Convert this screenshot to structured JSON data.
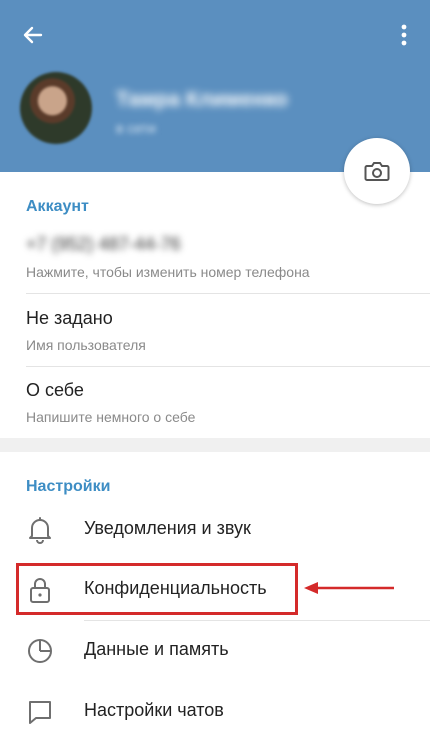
{
  "header": {
    "name": "Тамра Клименко",
    "status": "в сети",
    "accent_color": "#5b8fbf"
  },
  "account": {
    "title": "Аккаунт",
    "phone_value": "+7 (952) 487-44-76",
    "phone_hint": "Нажмите, чтобы изменить номер телефона",
    "username_value": "Не задано",
    "username_hint": "Имя пользователя",
    "bio_value": "О себе",
    "bio_hint": "Напишите немного о себе"
  },
  "settings": {
    "title": "Настройки",
    "items": [
      {
        "label": "Уведомления и звук",
        "icon": "bell-icon"
      },
      {
        "label": "Конфиденциальность",
        "icon": "lock-icon"
      },
      {
        "label": "Данные и память",
        "icon": "clock-icon"
      },
      {
        "label": "Настройки чатов",
        "icon": "chat-bubble-icon"
      }
    ]
  },
  "annotation": {
    "highlight_color": "#d42a2a"
  }
}
